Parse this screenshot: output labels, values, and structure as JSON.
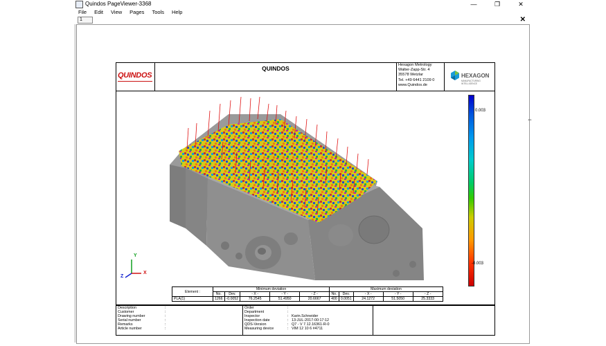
{
  "window": {
    "title": "Quindos PageViewer-3368",
    "controls": [
      "—",
      "❐",
      "✕"
    ]
  },
  "menu": [
    "File",
    "Edit",
    "View",
    "Pages",
    "Tools",
    "Help"
  ],
  "tab": {
    "label": "1",
    "close": "✕"
  },
  "report": {
    "logo": "QUINDOS",
    "title": "QUINDOS",
    "address": [
      "Hexagon Metrology",
      "Walter-Zapp-Str. 4",
      "35578 Wetzlar",
      "Tel. +49 6441 2109 0",
      "www.Quindos.de"
    ],
    "brand": "HEXAGON",
    "brand_sub": "MANUFACTURING INTELLIGENCE",
    "colorbar": {
      "top_label": "0.003",
      "bottom_label": "-0.003"
    },
    "axes": {
      "x": "X",
      "y": "Y",
      "z": "Z"
    },
    "deviation_table": {
      "element_label": "Element :",
      "min_header": "Minimum deviation",
      "max_header": "Maximum deviation",
      "columns": [
        "No.",
        "Dev.",
        "- X -",
        "- Y -",
        "- Z -",
        "No.",
        "Dev.",
        "- X -",
        "- Y -",
        "- Z -"
      ],
      "row": [
        "PLA(1)",
        "1266",
        "-0.0052",
        "76.2545",
        "51.4950",
        "20.6667",
        "400",
        "0.0051",
        "24.1272",
        "51.5050",
        "25.3333"
      ]
    },
    "footer": {
      "left": [
        {
          "k": "Description",
          "v": ""
        },
        {
          "k": "Customer",
          "v": ""
        },
        {
          "k": "Drawing number",
          "v": ""
        },
        {
          "k": "Serial number",
          "v": ""
        },
        {
          "k": "Remarks",
          "v": ""
        },
        {
          "k": "Article number",
          "v": ""
        }
      ],
      "middle": [
        {
          "k": "Order",
          "v": ""
        },
        {
          "k": "Department",
          "v": ""
        },
        {
          "k": "Inspector",
          "v": "Karin.Schneider"
        },
        {
          "k": "Inspection date",
          "v": "13-JUL-2017-00:17:12"
        },
        {
          "k": "QDS-Version",
          "v": "Q7 - V 7.12.16361-R-0"
        },
        {
          "k": "Measuring device",
          "v": "VIM 12 10 6 #4711"
        }
      ],
      "colon": ":"
    }
  }
}
